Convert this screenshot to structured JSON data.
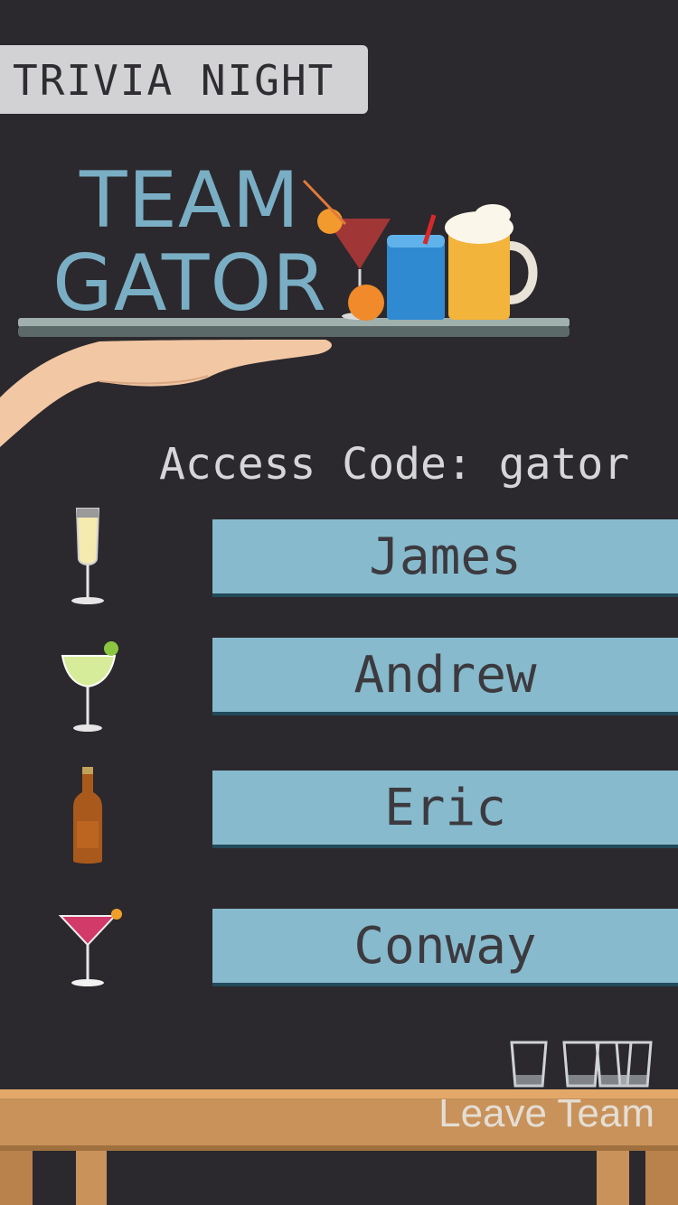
{
  "header": {
    "badge": "TRIVIA NIGHT"
  },
  "team": {
    "line1": "TEAM",
    "line2": "GATOR"
  },
  "access": {
    "label": "Access Code:",
    "code": "gator"
  },
  "members": [
    {
      "name": "James",
      "drink": "champagne-flute-icon"
    },
    {
      "name": "Andrew",
      "drink": "margarita-icon"
    },
    {
      "name": "Eric",
      "drink": "beer-bottle-icon"
    },
    {
      "name": "Conway",
      "drink": "cosmopolitan-icon"
    }
  ],
  "footer": {
    "leave_label": "Leave Team"
  },
  "colors": {
    "background": "#2b292d",
    "accent": "#87bacd",
    "title": "#7aaec4",
    "wood": "#c8925a"
  }
}
